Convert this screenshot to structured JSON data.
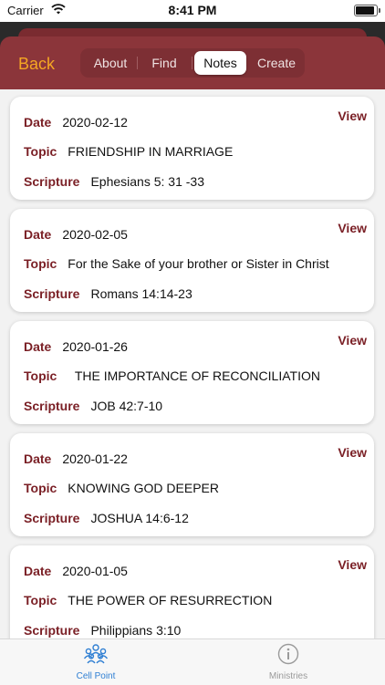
{
  "status": {
    "carrier": "Carrier",
    "time": "8:41 PM"
  },
  "nav": {
    "back_label": "Back",
    "segments": [
      "About",
      "Find",
      "Notes",
      "Create"
    ],
    "active_segment": "Notes"
  },
  "labels": {
    "date": "Date",
    "topic": "Topic",
    "scripture": "Scripture",
    "view": "View"
  },
  "notes": [
    {
      "date": "2020-02-12",
      "topic": "FRIENDSHIP IN MARRIAGE",
      "scripture": "Ephesians 5: 31 -33"
    },
    {
      "date": "2020-02-05",
      "topic": "For the Sake of your brother or Sister in Christ",
      "scripture": "Romans 14:14-23"
    },
    {
      "date": "2020-01-26",
      "topic": "  THE IMPORTANCE OF RECONCILIATION",
      "scripture": "JOB 42:7-10"
    },
    {
      "date": "2020-01-22",
      "topic": "KNOWING GOD DEEPER",
      "scripture": "JOSHUA 14:6-12"
    },
    {
      "date": "2020-01-05",
      "topic": "THE POWER OF RESURRECTION",
      "scripture": "Philippians 3:10"
    }
  ],
  "tabs": [
    {
      "label": "Cell Point",
      "icon": "people-group-icon",
      "active": true
    },
    {
      "label": "Ministries",
      "icon": "info-icon",
      "active": false
    }
  ],
  "colors": {
    "accent": "#8b353a",
    "label": "#7a1f25",
    "back": "#f5a623",
    "tab_active": "#2f7fd3"
  }
}
